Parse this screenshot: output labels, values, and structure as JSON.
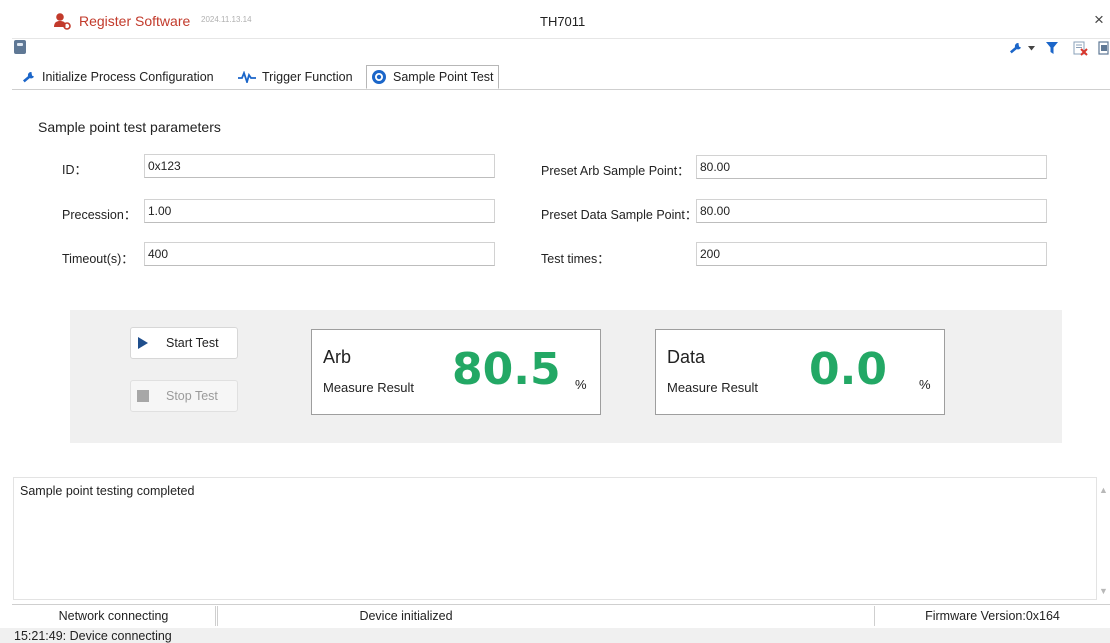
{
  "titlebar": {
    "app_name": "Register Software",
    "app_version": "2024.11.13.14",
    "window_title": "TH7011",
    "close_glyph": "×"
  },
  "toolbar": {
    "icons": [
      "device-icon",
      "wrench-icon",
      "dropdown-arrow-icon",
      "filter-icon",
      "clear-icon",
      "export-icon"
    ]
  },
  "tabs": [
    {
      "label": "Initialize Process Configuration",
      "icon": "wrench-icon",
      "selected": false
    },
    {
      "label": "Trigger Function",
      "icon": "waveform-icon",
      "selected": false
    },
    {
      "label": "Sample Point Test",
      "icon": "target-icon",
      "selected": true
    }
  ],
  "params": {
    "section_title": "Sample point test parameters",
    "id": {
      "label": "ID：",
      "value": "0x123"
    },
    "precession": {
      "label": "Precession：",
      "value": "1.00"
    },
    "timeout": {
      "label": "Timeout(s)：",
      "value": "400"
    },
    "preset_arb": {
      "label": "Preset Arb Sample Point：",
      "value": "80.00"
    },
    "preset_data": {
      "label": "Preset Data Sample Point：",
      "value": "80.00"
    },
    "test_times": {
      "label": "Test times：",
      "value": "200"
    }
  },
  "actions": {
    "start_label": "Start Test",
    "stop_label": "Stop Test"
  },
  "results": {
    "arb": {
      "title": "Arb",
      "subtitle": "Measure Result",
      "value": "80.5",
      "unit": "%"
    },
    "data": {
      "title": "Data",
      "subtitle": "Measure Result",
      "value": "0.0",
      "unit": "%"
    }
  },
  "log": {
    "text": "Sample point testing completed"
  },
  "status": {
    "network": "Network connecting",
    "device": "Device initialized",
    "firmware": "Firmware Version:0x164",
    "bottom_message": "15:21:49: Device connecting"
  },
  "colors": {
    "accent_red": "#c23a2b",
    "result_green": "#23a865",
    "panel_gray": "#f0f0f0",
    "toolbar_blue": "#1b66c9",
    "clear_red": "#d9362b"
  }
}
